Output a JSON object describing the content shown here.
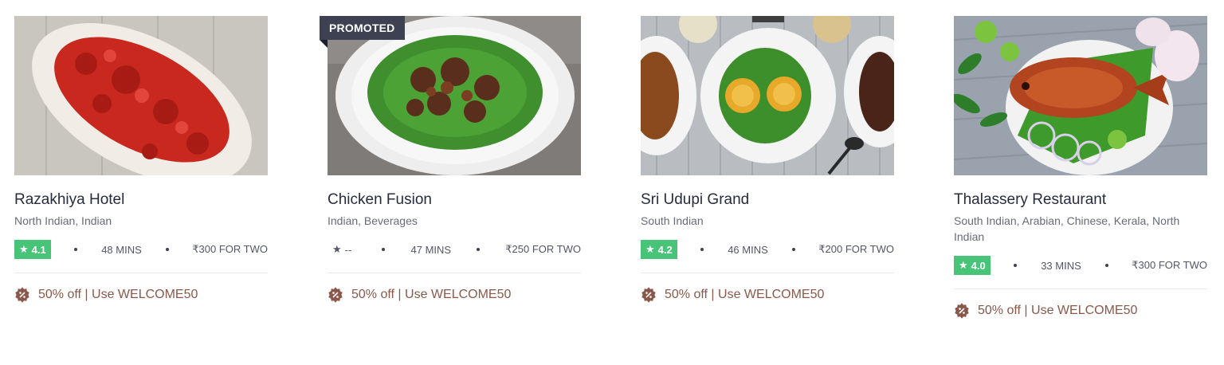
{
  "restaurants": [
    {
      "name": "Razakhiya Hotel",
      "cuisines": "North Indian, Indian",
      "rating": "4.1",
      "time": "48 MINS",
      "cost": "₹300 FOR TWO",
      "offer": "50% off | Use WELCOME50",
      "promoted": false
    },
    {
      "name": "Chicken Fusion",
      "cuisines": "Indian, Beverages",
      "rating": "--",
      "time": "47 MINS",
      "cost": "₹250 FOR TWO",
      "offer": "50% off | Use WELCOME50",
      "promoted": true,
      "promoted_label": "PROMOTED"
    },
    {
      "name": "Sri Udupi Grand",
      "cuisines": "South Indian",
      "rating": "4.2",
      "time": "46 MINS",
      "cost": "₹200 FOR TWO",
      "offer": "50% off | Use WELCOME50",
      "promoted": false
    },
    {
      "name": "Thalassery Restaurant",
      "cuisines": "South Indian, Arabian, Chinese, Kerala, North Indian",
      "rating": "4.0",
      "time": "33 MINS",
      "cost": "₹300 FOR TWO",
      "offer": "50% off | Use WELCOME50",
      "promoted": false
    }
  ],
  "icons": {
    "rating": "star-icon",
    "offer": "offer-percent-icon"
  },
  "colors": {
    "rating_green": "#48c479",
    "offer_brown": "#8a584b",
    "promoted_bg": "#3e4152"
  }
}
